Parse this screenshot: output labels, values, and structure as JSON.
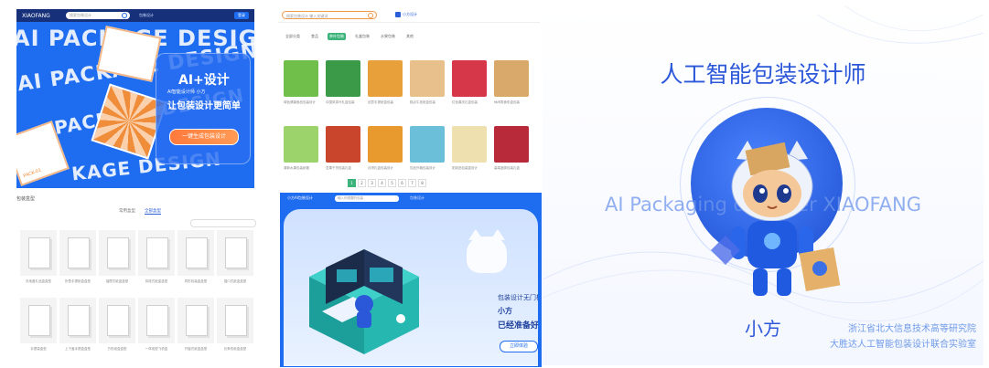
{
  "hero": {
    "nav_logo": "XIAOFANG",
    "search_placeholder": "搜索包装设计",
    "nav_link": "包装设计",
    "login": "登录",
    "bg_line1": "AI PACKAGE DESIGN",
    "bg_line2": "AI PACKAGE DESIGN",
    "bg_line3": "PACKAGE DESIGN",
    "bg_line4": "KAGE DESIGN",
    "box_tag": "PACK-01",
    "card_title": "AI+设计",
    "card_subtitle": "AI智能设计师 小方",
    "card_slogan": "让包装设计更简单",
    "card_button": "一键生成包装设计"
  },
  "grid": {
    "search_placeholder": "搜索包装设计 输入关键词",
    "brand": "小方设计",
    "filters": [
      "全部分类",
      "食品",
      "茶叶包装",
      "礼盒包装",
      "水果包装",
      "其他"
    ],
    "active_filter": 2,
    "products": [
      {
        "caption": "绿色健康食品包装设计",
        "color": "#6fbf4a"
      },
      {
        "caption": "中国风茶叶礼盒包装",
        "color": "#3a9a48"
      },
      {
        "caption": "创意手提纸盒包装",
        "color": "#e8a13a"
      },
      {
        "caption": "糕点牛皮纸盒包装",
        "color": "#e7c08c"
      },
      {
        "caption": "红色喜庆礼盒包装",
        "color": "#d6384a"
      },
      {
        "caption": "休闲零食彩盒包装",
        "color": "#d9a86b"
      },
      {
        "caption": "清新水果包装纸箱",
        "color": "#9cd36a"
      },
      {
        "caption": "坚果干货包装礼盒",
        "color": "#c9462c"
      },
      {
        "caption": "月饼礼盒包装设计",
        "color": "#e99a2e"
      },
      {
        "caption": "饮品外箱包装设计",
        "color": "#6bbfd9"
      },
      {
        "caption": "奶制品包装盒设计",
        "color": "#efe0b0"
      },
      {
        "caption": "高端酒类包装礼盒",
        "color": "#b82a3a"
      }
    ],
    "pages": [
      "1",
      "2",
      "3",
      "4",
      "5",
      "6",
      "7",
      "8"
    ],
    "active_page": 0
  },
  "library": {
    "title": "包装盒型",
    "tabs": [
      "常用盒型",
      "全部盒型"
    ],
    "active_tab": 1,
    "cells": [
      {
        "caption": "天地盖礼品盒盒型"
      },
      {
        "caption": "折叠手提纸盒盒型"
      },
      {
        "caption": "抽屉式纸盒盒型"
      },
      {
        "caption": "扣底式纸盒盒型"
      },
      {
        "caption": "异形包装盒盒型"
      },
      {
        "caption": "插口式纸盒盒型"
      },
      {
        "caption": "手提袋盒型"
      },
      {
        "caption": "上下盖手提盒盒型"
      },
      {
        "caption": "方形纸盒盒型"
      },
      {
        "caption": "一体成型飞机盒"
      },
      {
        "caption": "开窗式纸盒盒型"
      },
      {
        "caption": "长条形纸盒盒型"
      }
    ]
  },
  "landing": {
    "nav_logo": "小方AI包装设计",
    "search_placeholder": "输入你想要的包装",
    "nav_link": "包装设计",
    "line1": "包装设计无门槛",
    "line2": "小方",
    "line3": "已经准备好了",
    "button": "立即体验"
  },
  "poster": {
    "title": "人工智能包装设计师",
    "band": "AI Packaging designer   XIAOFANG",
    "name": "小方",
    "credit_line1": "浙江省北大信息技术高等研究院",
    "credit_line2": "大胜达人工智能包装设计联合实验室"
  },
  "colors": {
    "brand_blue": "#1e6cf0",
    "accent_orange": "#ff7a3c",
    "filter_green": "#3bb37a",
    "poster_blue": "#2c57d8"
  }
}
